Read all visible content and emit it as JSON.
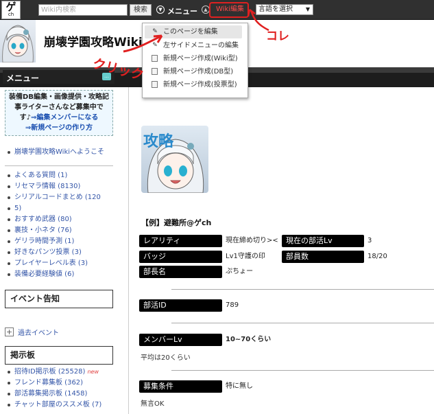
{
  "topbar": {
    "logo_text": "ゲ",
    "logo_sub": "ch",
    "search_placeholder": "Wiki内検索",
    "search_button": "検索",
    "menu_label": "メニュー",
    "wiki_edit_label": "Wiki編集",
    "language_select": "言語を選択"
  },
  "header": {
    "site_title": "崩壊学園攻略Wiki"
  },
  "edit_dropdown": {
    "items": [
      {
        "label": "このページを編集",
        "icon": "pencil-icon"
      },
      {
        "label": "左サイドメニューの編集",
        "icon": "pencil-icon"
      },
      {
        "label": "新規ページ作成(Wiki型)",
        "icon": "page-icon"
      },
      {
        "label": "新規ページ作成(DB型)",
        "icon": "page-icon"
      },
      {
        "label": "新規ページ作成(投票型)",
        "icon": "page-icon"
      }
    ]
  },
  "sidebar": {
    "title": "メニュー",
    "notice_lines": [
      "装備DB編集・画像提供・攻略記",
      "事ライターさんなど募集中で",
      "す♪",
      "⇒編集メンバーになる",
      "⇒新規ページの作り方"
    ],
    "welcome_link": "崩壊学園攻略Wikiへようこそ",
    "menu_links": [
      "よくある質問 (1)",
      "リセマラ情報 (8130)",
      "シリアルコードまとめ (120",
      "5)",
      "おすすめ武器 (80)",
      "裏技・小ネタ (76)",
      "ゲリラ時間予測 (1)",
      "好きなパンツ投票 (3)",
      "プレイヤーレベル表 (3)",
      "装備必要経験値 (6)"
    ],
    "event_section": "イベント告知",
    "past_events": "過去イベント",
    "board_section": "掲示板",
    "board_links": [
      "招待ID掲示板 (25528)",
      "フレンド募集板 (362)",
      "部活募集掲示板 (1458)",
      "チャット部屋のススメ板 (7)"
    ],
    "new_badge": "new"
  },
  "content": {
    "icon_text": "攻略",
    "example_title": "【例】避難所@ゲch",
    "fields": {
      "rarity_label": "レアリティ",
      "rarity_value": "現在締め切り><",
      "club_lv_label": "現在の部活Lv",
      "club_lv_value": "3",
      "badge_label": "バッジ",
      "badge_value": "Lv1守護の印",
      "members_label": "部員数",
      "members_value": "18/20",
      "leader_label": "部長名",
      "leader_value": "ぷちょー",
      "club_id_label": "部活ID",
      "club_id_value": "789",
      "member_lv_label": "メンバーLv",
      "member_lv_value": "10~70くらい",
      "member_lv_note": "平均は20くらい",
      "recruit_label": "募集条件",
      "recruit_value": "特に無し",
      "recruit_note": "無言OK"
    }
  },
  "annotations": {
    "kore": "コレ",
    "click": "クリック",
    "color": "#e02020"
  }
}
